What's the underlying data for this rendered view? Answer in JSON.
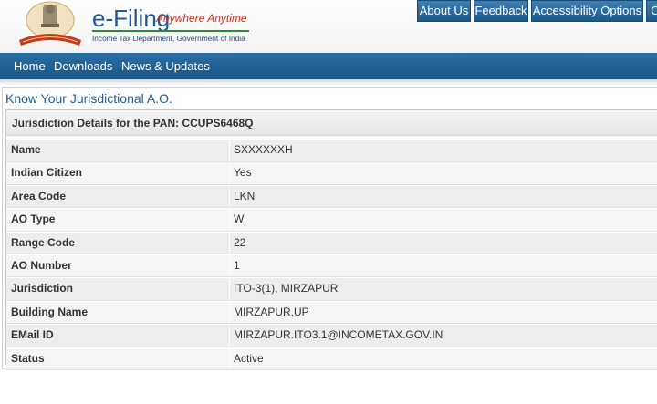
{
  "brand": {
    "title": "e-Filing",
    "tagline": "Anywhere Anytime",
    "subtitle": "Income Tax Department, Government of India"
  },
  "top_links": [
    "About Us",
    "Feedback",
    "Accessibility Options",
    "C"
  ],
  "nav": [
    "Home",
    "Downloads",
    "News & Updates"
  ],
  "page": {
    "title": "Know Your Jurisdictional A.O.",
    "details_header": "Jurisdiction Details for the PAN: CCUPS6468Q"
  },
  "rows": [
    {
      "label": "Name",
      "value": "SXXXXXXH"
    },
    {
      "label": "Indian Citizen",
      "value": "Yes"
    },
    {
      "label": "Area Code",
      "value": "LKN"
    },
    {
      "label": "AO Type",
      "value": "W"
    },
    {
      "label": "Range Code",
      "value": "22"
    },
    {
      "label": "AO Number",
      "value": "1"
    },
    {
      "label": "Jurisdiction",
      "value": "ITO-3(1), MIRZAPUR"
    },
    {
      "label": "Building Name",
      "value": "MIRZAPUR,UP"
    },
    {
      "label": "EMail ID",
      "value": "MIRZAPUR.ITO3.1@INCOMETAX.GOV.IN"
    },
    {
      "label": "Status",
      "value": "Active"
    }
  ],
  "colors": {
    "brand_blue": "#1d5b93",
    "tagline_red": "#d0311f",
    "nav_blue": "#1b5687"
  }
}
